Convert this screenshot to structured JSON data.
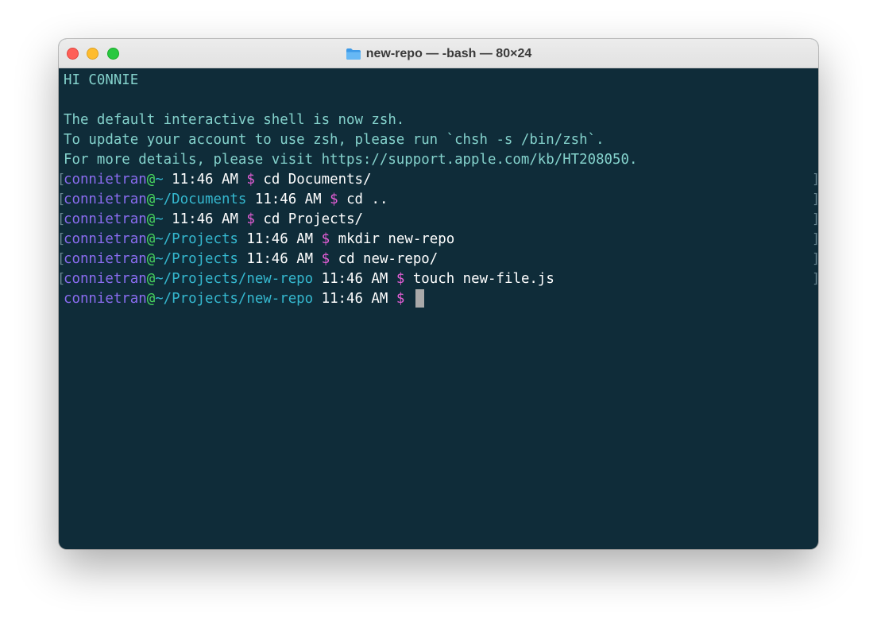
{
  "window": {
    "title": "new-repo — -bash — 80×24",
    "title_icon": "folder-icon"
  },
  "colors": {
    "background": "#0f2c39",
    "text": "#84d2cc",
    "user": "#8a6cf0",
    "at": "#48d65f",
    "path": "#35b8cf",
    "time": "#ffffff",
    "dollar": "#e65ed8"
  },
  "output": {
    "greeting": "HI C0NNIE",
    "notice_1": "The default interactive shell is now zsh.",
    "notice_2": "To update your account to use zsh, please run `chsh -s /bin/zsh`.",
    "notice_3": "For more details, please visit https://support.apple.com/kb/HT208050."
  },
  "prompts": [
    {
      "user": "connietran",
      "at": "@",
      "path": "~",
      "time": "11:46 AM",
      "dollar": "$",
      "command": "cd Documents/"
    },
    {
      "user": "connietran",
      "at": "@",
      "path": "~/Documents",
      "time": "11:46 AM",
      "dollar": "$",
      "command": "cd .."
    },
    {
      "user": "connietran",
      "at": "@",
      "path": "~",
      "time": "11:46 AM",
      "dollar": "$",
      "command": "cd Projects/"
    },
    {
      "user": "connietran",
      "at": "@",
      "path": "~/Projects",
      "time": "11:46 AM",
      "dollar": "$",
      "command": "mkdir new-repo"
    },
    {
      "user": "connietran",
      "at": "@",
      "path": "~/Projects",
      "time": "11:46 AM",
      "dollar": "$",
      "command": "cd new-repo/"
    },
    {
      "user": "connietran",
      "at": "@",
      "path": "~/Projects/new-repo",
      "time": "11:46 AM",
      "dollar": "$",
      "command": "touch new-file.js"
    },
    {
      "user": "connietran",
      "at": "@",
      "path": "~/Projects/new-repo",
      "time": "11:46 AM",
      "dollar": "$",
      "command": ""
    }
  ],
  "marks": {
    "left": "[",
    "right": "]"
  }
}
